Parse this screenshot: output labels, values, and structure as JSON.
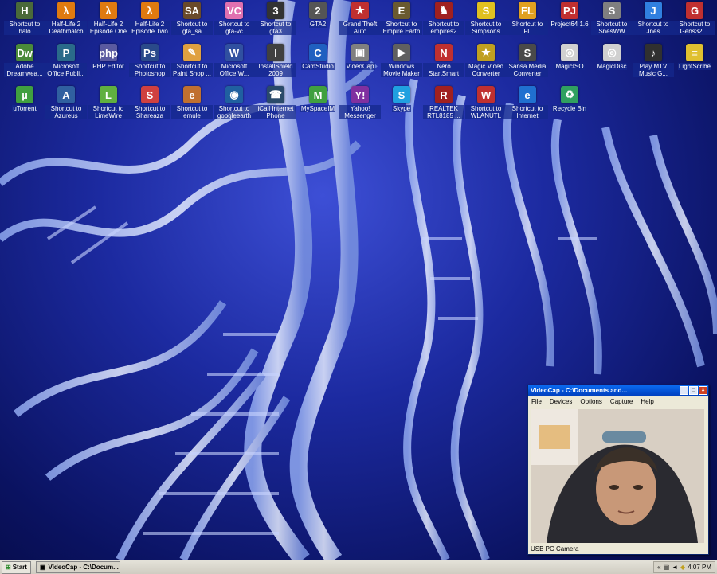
{
  "desktop_icons": [
    {
      "label": "Shortcut to halo",
      "icon": "halo-icon",
      "color": "#4a6a3a",
      "glyph": "H"
    },
    {
      "label": "Half-Life 2 Deathmatch",
      "icon": "lambda-icon",
      "color": "#e07a10",
      "glyph": "λ"
    },
    {
      "label": "Half-Life 2 Episode One",
      "icon": "lambda-icon",
      "color": "#e07a10",
      "glyph": "λ"
    },
    {
      "label": "Half-Life 2 Episode Two",
      "icon": "lambda-icon",
      "color": "#e07a10",
      "glyph": "λ"
    },
    {
      "label": "Shortcut to gta_sa",
      "icon": "gta-sa-icon",
      "color": "#6a4a2a",
      "glyph": "SA"
    },
    {
      "label": "Shortcut to gta-vc",
      "icon": "gta-vc-icon",
      "color": "#e070b0",
      "glyph": "VC"
    },
    {
      "label": "Shortcut to gta3",
      "icon": "gta3-icon",
      "color": "#333333",
      "glyph": "3"
    },
    {
      "label": "GTA2",
      "icon": "gta2-icon",
      "color": "#555555",
      "glyph": "2"
    },
    {
      "label": "Grand Theft Auto",
      "icon": "usa-flag-icon",
      "color": "#c03030",
      "glyph": "★"
    },
    {
      "label": "Shortcut to Empire Earth",
      "icon": "empire-earth-icon",
      "color": "#6a5a30",
      "glyph": "E"
    },
    {
      "label": "Shortcut to empires2",
      "icon": "empires2-icon",
      "color": "#a02020",
      "glyph": "♞"
    },
    {
      "label": "Shortcut to Simpsons",
      "icon": "simpsons-icon",
      "color": "#e0c020",
      "glyph": "S"
    },
    {
      "label": "Shortcut to FL",
      "icon": "fl-studio-icon",
      "color": "#e0a020",
      "glyph": "FL"
    },
    {
      "label": "Project64 1.6",
      "icon": "project64-icon",
      "color": "#c03030",
      "glyph": "PJ"
    },
    {
      "label": "Shortcut to SnesWW",
      "icon": "snes-icon",
      "color": "#808080",
      "glyph": "S"
    },
    {
      "label": "Shortcut to Jnes",
      "icon": "jnes-icon",
      "color": "#3080e0",
      "glyph": "J"
    },
    {
      "label": "Shortcut to Gens32 ...",
      "icon": "gens-icon",
      "color": "#c03030",
      "glyph": "G"
    },
    {
      "label": "Adobe Dreamwea...",
      "icon": "dreamweaver-icon",
      "color": "#4a8a3a",
      "glyph": "Dw"
    },
    {
      "label": "Microsoft Office Publi...",
      "icon": "publisher-icon",
      "color": "#2a6a8a",
      "glyph": "P"
    },
    {
      "label": "PHP Editor",
      "icon": "php-icon",
      "color": "#5a5aa0",
      "glyph": "php"
    },
    {
      "label": "Shortcut to Photoshop",
      "icon": "photoshop-icon",
      "color": "#2a4a8a",
      "glyph": "Ps"
    },
    {
      "label": "Shortcut to Paint Shop ...",
      "icon": "paint-shop-icon",
      "color": "#e0a040",
      "glyph": "✎"
    },
    {
      "label": "Microsoft Office W...",
      "icon": "word-icon",
      "color": "#3050a0",
      "glyph": "W"
    },
    {
      "label": "InstallShield 2009",
      "icon": "installshield-icon",
      "color": "#404040",
      "glyph": "I"
    },
    {
      "label": "CamStudio",
      "icon": "camstudio-icon",
      "color": "#2060c0",
      "glyph": "C"
    },
    {
      "label": "VideoCap",
      "icon": "videocap-icon",
      "color": "#808080",
      "glyph": "▣"
    },
    {
      "label": "Windows Movie Maker",
      "icon": "movie-maker-icon",
      "color": "#606060",
      "glyph": "▶"
    },
    {
      "label": "Nero StartSmart",
      "icon": "nero-icon",
      "color": "#c03030",
      "glyph": "N"
    },
    {
      "label": "Magic Video Converter",
      "icon": "magic-video-icon",
      "color": "#c0a020",
      "glyph": "★"
    },
    {
      "label": "Sansa Media Converter",
      "icon": "sansa-icon",
      "color": "#4a4a4a",
      "glyph": "S"
    },
    {
      "label": "MagicISO",
      "icon": "magiciso-icon",
      "color": "#d0d0d0",
      "glyph": "◎"
    },
    {
      "label": "MagicDisc",
      "icon": "magicdisc-icon",
      "color": "#d0d0d0",
      "glyph": "◎"
    },
    {
      "label": "Play MTV Music G...",
      "icon": "mtv-icon",
      "color": "#303030",
      "glyph": "♪"
    },
    {
      "label": "LightScribe",
      "icon": "lightscribe-icon",
      "color": "#e0c030",
      "glyph": "≡"
    },
    {
      "label": "uTorrent",
      "icon": "utorrent-icon",
      "color": "#40a040",
      "glyph": "µ"
    },
    {
      "label": "Shortcut to Azureus",
      "icon": "azureus-icon",
      "color": "#3060a0",
      "glyph": "A"
    },
    {
      "label": "Shortcut to LimeWire",
      "icon": "limewire-icon",
      "color": "#60b040",
      "glyph": "L"
    },
    {
      "label": "Shortcut to Shareaza",
      "icon": "shareaza-icon",
      "color": "#d04040",
      "glyph": "S"
    },
    {
      "label": "Shortcut to emule",
      "icon": "emule-icon",
      "color": "#c07030",
      "glyph": "e"
    },
    {
      "label": "Shortcut to googleearth",
      "icon": "googleearth-icon",
      "color": "#2060a0",
      "glyph": "◉"
    },
    {
      "label": "iCall Internet Phone",
      "icon": "phone-icon",
      "color": "#2a4a6a",
      "glyph": "☎"
    },
    {
      "label": "MySpaceIM",
      "icon": "myspace-icon",
      "color": "#40a040",
      "glyph": "M"
    },
    {
      "label": "Yahoo! Messenger",
      "icon": "yahoo-icon",
      "color": "#8030a0",
      "glyph": "Y!"
    },
    {
      "label": "Skype",
      "icon": "skype-icon",
      "color": "#20a0e0",
      "glyph": "S"
    },
    {
      "label": "REALTEK RTL8185 ...",
      "icon": "realtek-icon",
      "color": "#a02020",
      "glyph": "R"
    },
    {
      "label": "Shortcut to WLANUTL",
      "icon": "wlan-icon",
      "color": "#c03030",
      "glyph": "W"
    },
    {
      "label": "Shortcut to Internet",
      "icon": "ie-icon",
      "color": "#2070d0",
      "glyph": "e"
    },
    {
      "label": "Recycle Bin",
      "icon": "recycle-bin-icon",
      "color": "#30a060",
      "glyph": "♻"
    }
  ],
  "videocap": {
    "title": "VideoCap - C:\\Documents and...",
    "menu": [
      "File",
      "Devices",
      "Options",
      "Capture",
      "Help"
    ],
    "status": "USB PC Camera"
  },
  "taskbar": {
    "start_label": "Start",
    "task_label": "VideoCap - C:\\Docum...",
    "clock": "4:07 PM"
  }
}
